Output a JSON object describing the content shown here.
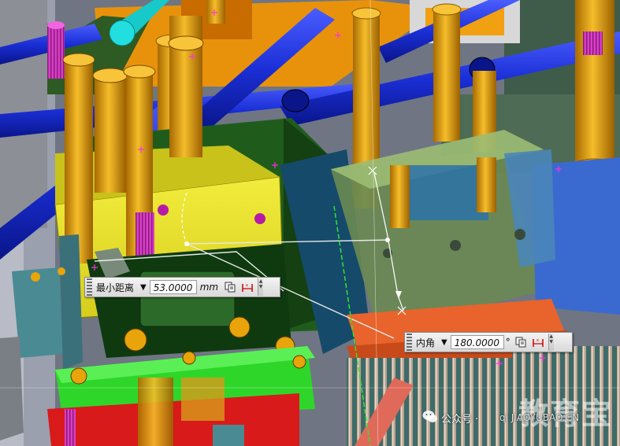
{
  "viewport": {
    "description_none": ""
  },
  "dimension_min_distance": {
    "label": "最小距离",
    "value": "53.0000",
    "unit": "mm"
  },
  "dimension_inner_angle": {
    "label": "内角",
    "value": "180.0000",
    "unit": "°"
  },
  "dropdown_arrow": "▼",
  "watermark": {
    "account": "公众号 ·",
    "site": "qi JIAOYUBAO.CN",
    "brand": "教育宝"
  },
  "colors": {
    "mold_yellow": "#e6df2a",
    "cooling_blue": "#1a2fd6",
    "bolt_orange": "#f0a40a",
    "plate_green": "#2fd62a",
    "transparent_green": "#a9c98c"
  }
}
